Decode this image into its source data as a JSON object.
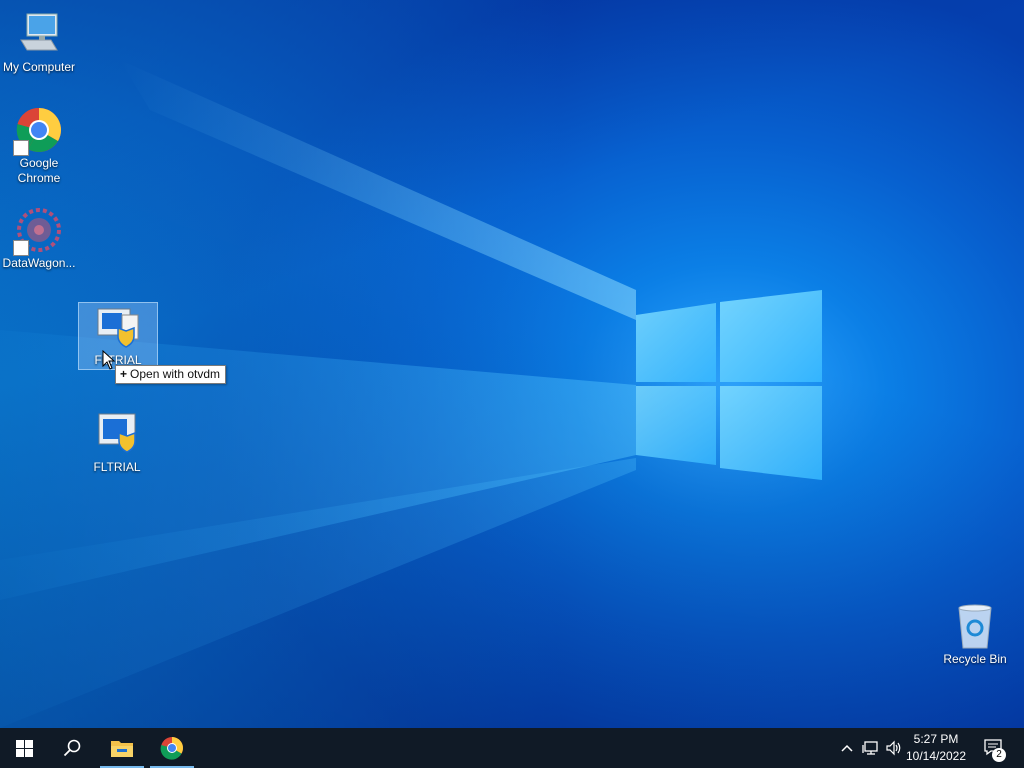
{
  "desktop": {
    "icons": [
      {
        "label": "My Computer"
      },
      {
        "label": "Google Chrome"
      },
      {
        "label": "DataWagon..."
      },
      {
        "label": "FLTRIAL"
      },
      {
        "label": "FLTRIAL"
      },
      {
        "label": "Recycle Bin"
      }
    ],
    "drag_tooltip": "Open with otvdm"
  },
  "taskbar": {
    "clock_time": "5:27 PM",
    "clock_date": "10/14/2022",
    "notification_count": "2"
  },
  "colors": {
    "taskbar_bg": "#101a26",
    "accent": "#76b9ed",
    "desktop_blue": "#0b7fe6"
  }
}
